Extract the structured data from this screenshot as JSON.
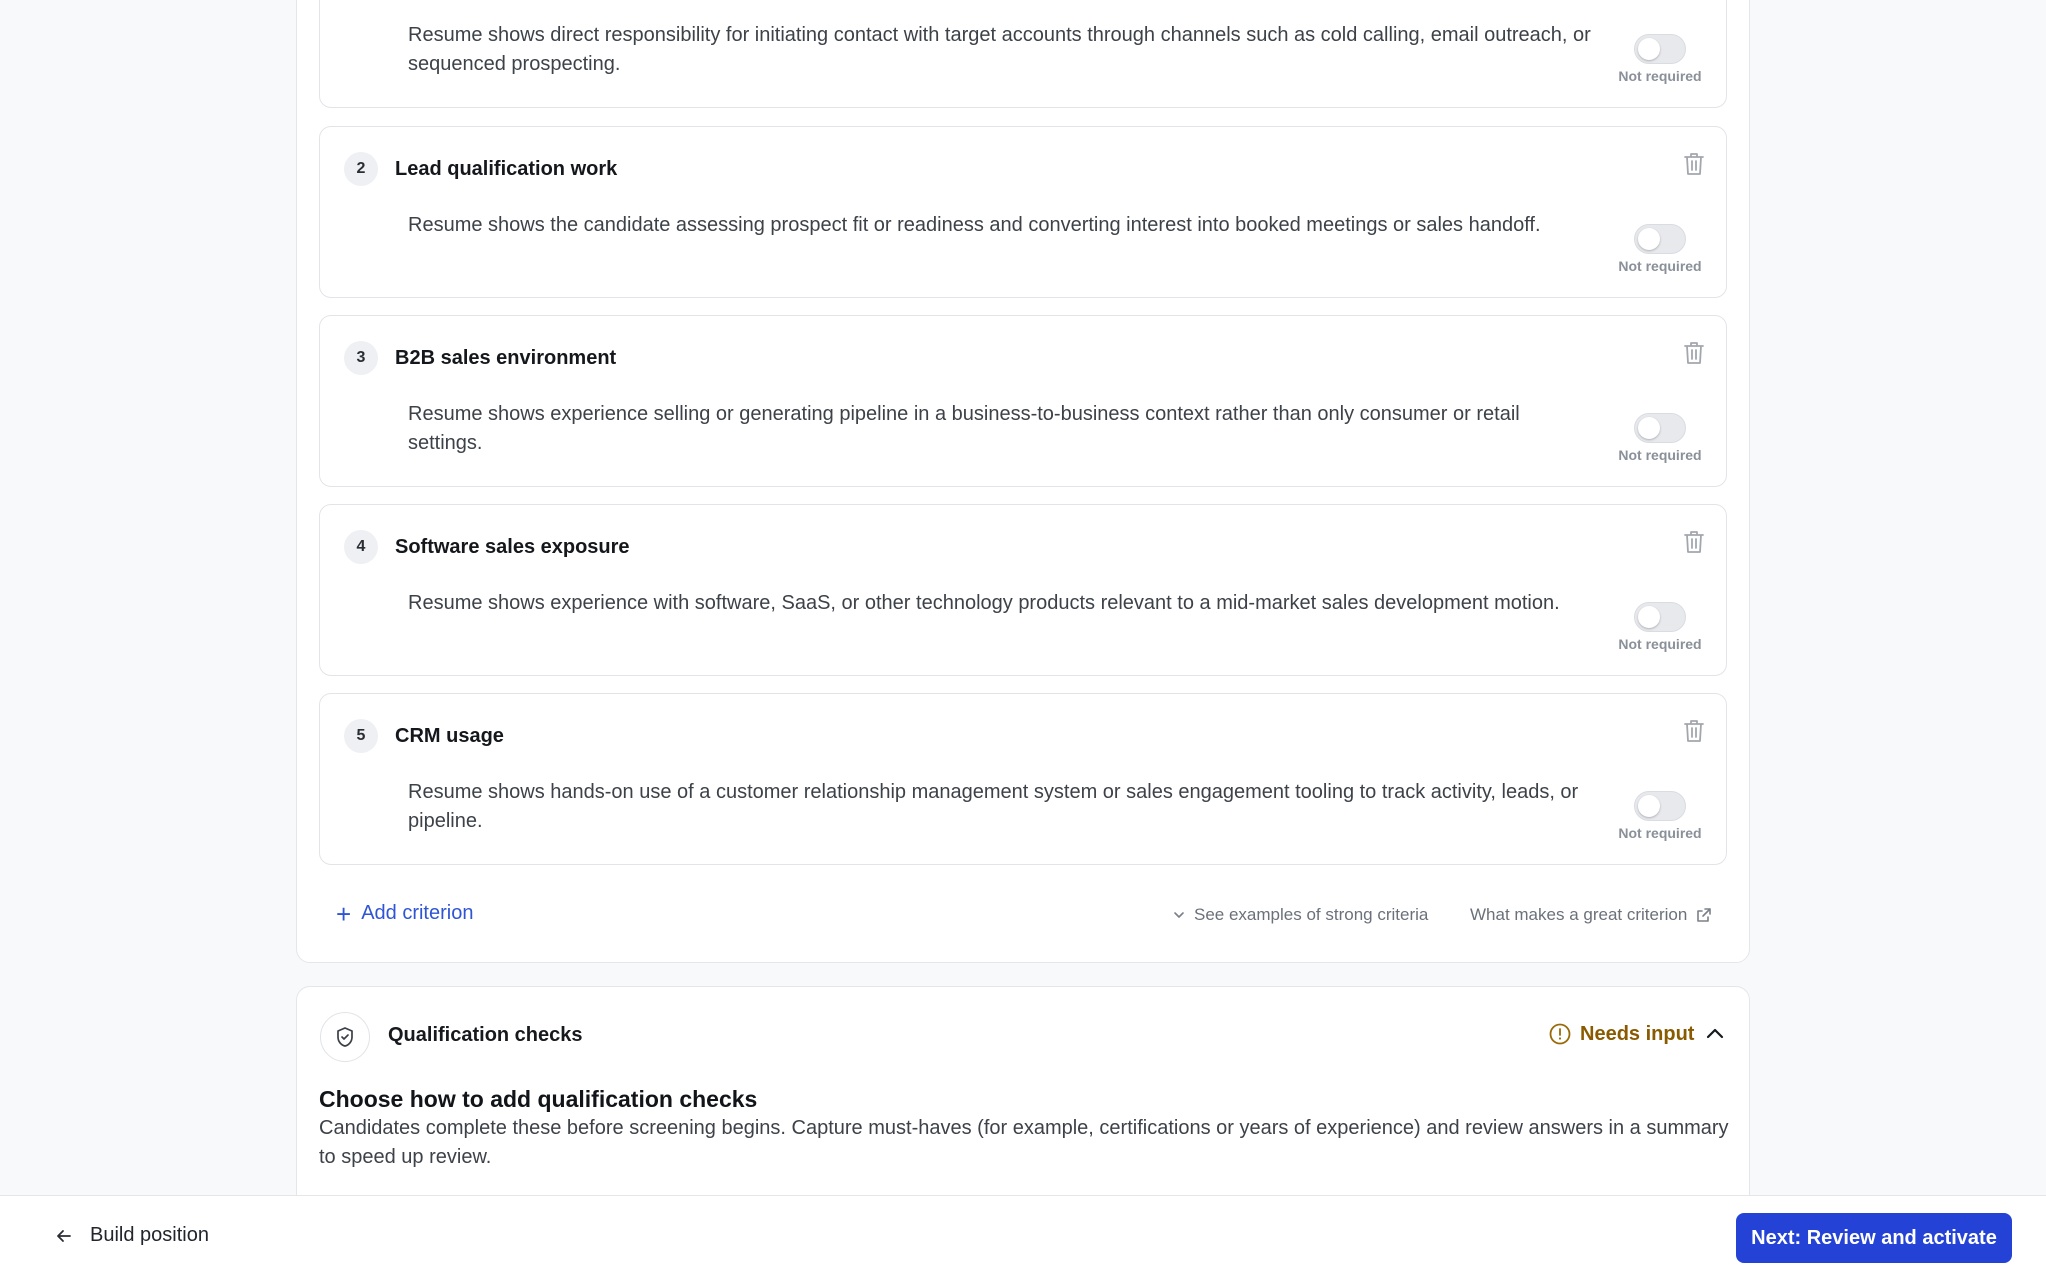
{
  "criteria": [
    {
      "number": "",
      "title": "",
      "description": "Resume shows direct responsibility for initiating contact with target accounts through channels such as cold calling, email outreach, or sequenced prospecting.",
      "required_label": "Not required",
      "required": false
    },
    {
      "number": "2",
      "title": "Lead qualification work",
      "description": "Resume shows the candidate assessing prospect fit or readiness and converting interest into booked meetings or sales handoff.",
      "required_label": "Not required",
      "required": false
    },
    {
      "number": "3",
      "title": "B2B sales environment",
      "description": "Resume shows experience selling or generating pipeline in a business-to-business context rather than only consumer or retail settings.",
      "required_label": "Not required",
      "required": false
    },
    {
      "number": "4",
      "title": "Software sales exposure",
      "description": "Resume shows experience with software, SaaS, or other technology products relevant to a mid-market sales development motion.",
      "required_label": "Not required",
      "required": false
    },
    {
      "number": "5",
      "title": "CRM usage",
      "description": "Resume shows hands-on use of a customer relationship management system or sales engagement tooling to track activity, leads, or pipeline.",
      "required_label": "Not required",
      "required": false
    }
  ],
  "criteria_actions": {
    "add_label": "Add criterion",
    "examples_label": "See examples of strong criteria",
    "great_criterion_label": "What makes a great criterion"
  },
  "qualification": {
    "title": "Qualification checks",
    "status": "Needs input",
    "heading": "Choose how to add qualification checks",
    "description": "Candidates complete these before screening begins. Capture must-haves (for example, certifications or years of experience) and review answers in a summary to speed up review."
  },
  "footer": {
    "back_label": "Build position",
    "next_label": "Next: Review and activate"
  },
  "colors": {
    "accent": "#2443d6",
    "link": "#2f55d4",
    "warning": "#8a5a00"
  }
}
